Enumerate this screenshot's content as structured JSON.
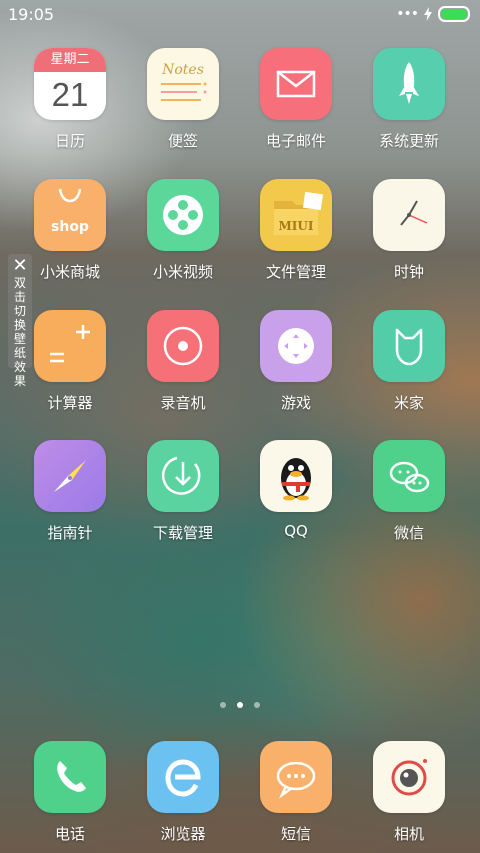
{
  "status_bar": {
    "time": "19:05",
    "more_dots": "•••",
    "battery_color": "#3ddb57"
  },
  "calendar_icon": {
    "weekday": "星期二",
    "day": "21"
  },
  "notes_icon": {
    "title": "Notes"
  },
  "shop_icon": {
    "text": "shop"
  },
  "files_icon": {
    "text": "MIUI"
  },
  "apps": [
    {
      "label": "日历"
    },
    {
      "label": "便签"
    },
    {
      "label": "电子邮件"
    },
    {
      "label": "系统更新"
    },
    {
      "label": "小米商城"
    },
    {
      "label": "小米视频"
    },
    {
      "label": "文件管理"
    },
    {
      "label": "时钟"
    },
    {
      "label": "计算器"
    },
    {
      "label": "录音机"
    },
    {
      "label": "游戏"
    },
    {
      "label": "米家"
    },
    {
      "label": "指南针"
    },
    {
      "label": "下载管理"
    },
    {
      "label": "QQ"
    },
    {
      "label": "微信"
    }
  ],
  "dock": [
    {
      "label": "电话"
    },
    {
      "label": "浏览器"
    },
    {
      "label": "短信"
    },
    {
      "label": "相机"
    }
  ],
  "tip": {
    "close": "✕",
    "chars": [
      "双",
      "击",
      "切",
      "换",
      "壁",
      "纸",
      "效",
      "果"
    ]
  },
  "pager": {
    "pages": 3,
    "current": 2
  }
}
